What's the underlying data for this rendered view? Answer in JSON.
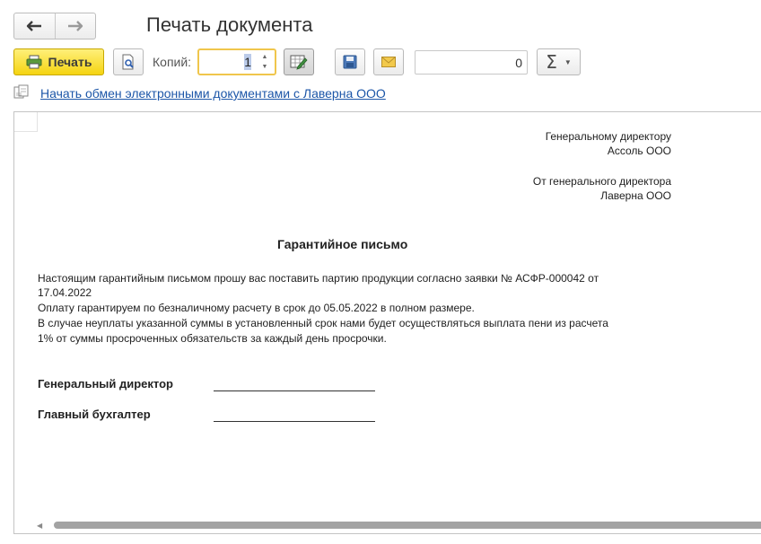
{
  "window": {
    "title": "Печать документа"
  },
  "nav": {
    "back_icon": "arrow-left-icon",
    "forward_icon": "arrow-right-icon"
  },
  "toolbar": {
    "print_label": "Печать",
    "copies_label": "Копий:",
    "copies_value": "1",
    "sum_value": "0",
    "sum_icon": "Σ",
    "accent_color": "#f5d411"
  },
  "exchange_link": "Начать обмен электронными документами с Лаверна ООО",
  "document": {
    "recipient_line1": "Генеральному директору",
    "recipient_line2": "Ассоль ООО",
    "sender_line1": "От генерального директора",
    "sender_line2": "Лаверна ООО",
    "heading": "Гарантийное письмо",
    "body_lines": [
      "Настоящим гарантийным письмом прошу вас поставить партию продукции согласно заявки № АСФР-000042 от",
      "17.04.2022",
      "Оплату гарантируем по безналичному расчету в срок до 05.05.2022 в полном размере.",
      "В случае неуплаты указанной суммы в установленный срок нами будет осуществляться выплата пени из расчета",
      "1% от суммы просроченных обязательств за каждый день просрочки."
    ],
    "sign_director": "Генеральный директор",
    "sign_accountant": "Главный бухгалтер"
  }
}
